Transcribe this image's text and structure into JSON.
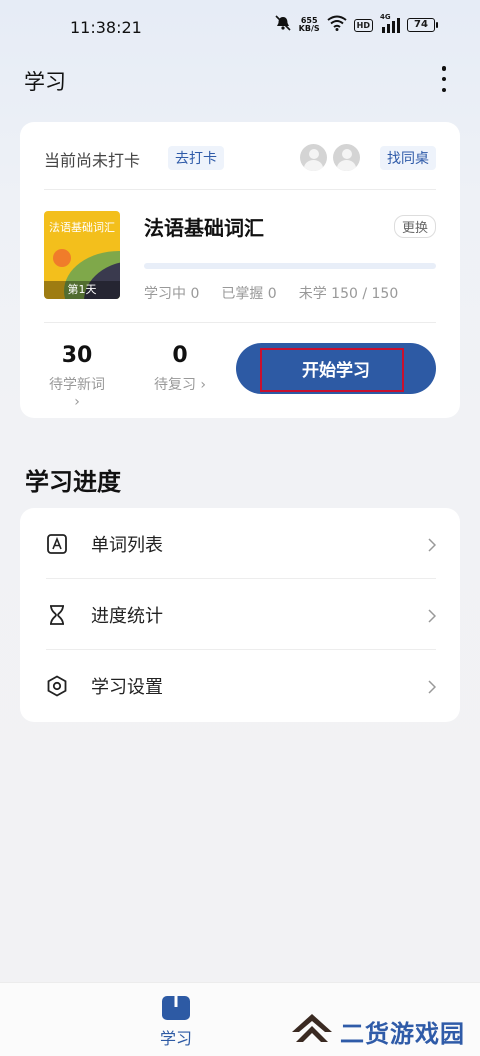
{
  "status_bar": {
    "time": "11:38:21",
    "net_speed_value": "655",
    "net_speed_unit": "KB/S",
    "hd_label": "HD",
    "network_label": "4G",
    "battery": "74"
  },
  "header": {
    "title": "学习"
  },
  "checkin": {
    "status_text": "当前尚未打卡",
    "checkin_button": "去打卡",
    "find_desk_button": "找同桌"
  },
  "book": {
    "cover_title": "法语基础词汇",
    "cover_day": "第1天",
    "title": "法语基础词汇",
    "change_button": "更换",
    "progress_fraction": 0,
    "stats": {
      "learning": "学习中 0",
      "mastered": "已掌握 0",
      "unlearned": "未学 150 / 150"
    }
  },
  "counts": {
    "new_words_value": "30",
    "new_words_label": "待学新词 ›",
    "review_value": "0",
    "review_label": "待复习 ›"
  },
  "start_button": "开始学习",
  "progress_section": {
    "title": "学习进度",
    "items": [
      {
        "label": "单词列表",
        "icon": "letter-a-box-icon"
      },
      {
        "label": "进度统计",
        "icon": "hourglass-icon"
      },
      {
        "label": "学习设置",
        "icon": "hexagon-settings-icon"
      }
    ]
  },
  "bottom_nav": {
    "tabs": [
      {
        "label": "学习",
        "icon": "book-icon",
        "active": true
      }
    ]
  },
  "watermark": {
    "text": "二货游戏园"
  },
  "colors": {
    "accent": "#2d5aa4",
    "highlight_box": "#c8102e",
    "cover_yellow": "#f3bf1c"
  }
}
